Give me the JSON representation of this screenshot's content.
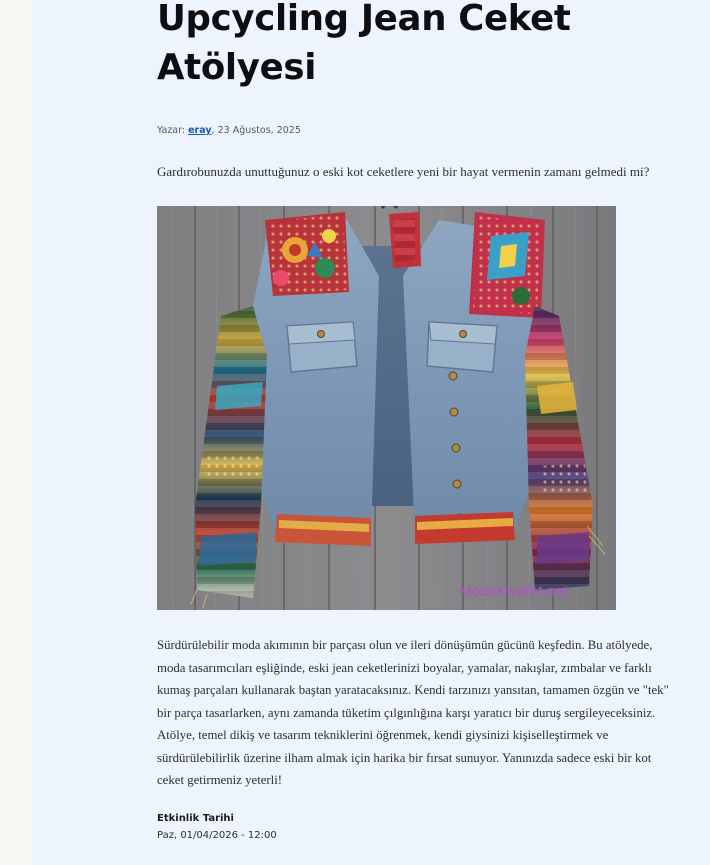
{
  "article": {
    "title": "Upcycling Jean Ceket Atölyesi",
    "byline_prefix": "Yazar: ",
    "author": "eray",
    "date": ", 23 Ağustos, 2025",
    "intro": "Gardırobunuzda unuttuğunuz o eski kot ceketlere yeni bir hayat vermenin zamanı gelmedi mi?",
    "image_watermark": "ModaKiyafet.net",
    "body": " Sürdürülebilir moda akımının bir parçası olun ve ileri dönüşümün gücünü keşfedin. Bu atölyede, moda tasarımcıları eşliğinde, eski jean ceketlerinizi boyalar, yamalar, nakışlar, zımbalar ve farklı kumaş parçaları kullanarak baştan yaratacaksınız. Kendi tarzınızı yansıtan, tamamen özgün ve \"tek\" bir parça tasarlarken, aynı zamanda tüketim çılgınlığına karşı yaratıcı bir duruş sergileyeceksiniz. Atölye, temel dikiş ve tasarım tekniklerini öğrenmek, kendi giysinizi kişiselleştirmek ve sürdürülebilirlik üzerine ilham almak için harika bir fırsat sunuyor. Yanınızda sadece eski bir kot ceket getirmeniz yeterli!"
  },
  "event": {
    "date_label": "Etkinlik Tarihi",
    "date_value": "Paz, 01/04/2026 - 12:00"
  },
  "colors": {
    "panel_background": "#eef4fd",
    "gutter_background": "#f7f6f3",
    "link": "#1a56b0",
    "title": "#0e0e12",
    "watermark": "#b04fc8"
  }
}
